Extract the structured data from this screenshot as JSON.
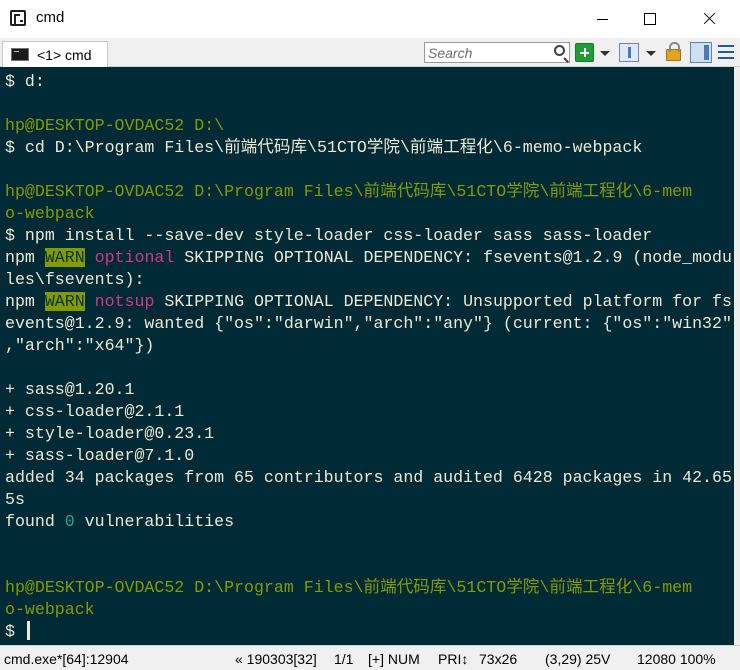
{
  "window": {
    "title": "cmd",
    "tab_label": "<1> cmd"
  },
  "toolbar": {
    "search_placeholder": "Search"
  },
  "console": {
    "lines": [
      [
        {
          "t": "$ d:",
          "c": "text"
        }
      ],
      [
        {
          "t": "",
          "c": "text"
        }
      ],
      [
        {
          "t": "hp@DESKTOP-OVDAC52",
          "c": "user"
        },
        {
          "t": " ",
          "c": "text"
        },
        {
          "t": "D:\\",
          "c": "path"
        }
      ],
      [
        {
          "t": "$ cd D:\\Program Files\\前端代码库\\51CTO学院\\前端工程化\\6-memo-webpack",
          "c": "text"
        }
      ],
      [
        {
          "t": "",
          "c": "text"
        }
      ],
      [
        {
          "t": "hp@DESKTOP-OVDAC52",
          "c": "user"
        },
        {
          "t": " ",
          "c": "text"
        },
        {
          "t": "D:\\Program Files\\前端代码库\\51CTO学院\\前端工程化\\6-mem",
          "c": "path"
        }
      ],
      [
        {
          "t": "o-webpack",
          "c": "path"
        }
      ],
      [
        {
          "t": "$ npm install --save-dev style-loader css-loader sass sass-loader",
          "c": "text"
        }
      ],
      [
        {
          "t": "npm ",
          "c": "text"
        },
        {
          "t": "WARN",
          "c": "warn"
        },
        {
          "t": " ",
          "c": "text"
        },
        {
          "t": "optional",
          "c": "optional"
        },
        {
          "t": " SKIPPING OPTIONAL DEPENDENCY: fsevents@1.2.9 (node_modu",
          "c": "text"
        }
      ],
      [
        {
          "t": "les\\fsevents):",
          "c": "text"
        }
      ],
      [
        {
          "t": "npm ",
          "c": "text"
        },
        {
          "t": "WARN",
          "c": "warn"
        },
        {
          "t": " ",
          "c": "text"
        },
        {
          "t": "notsup",
          "c": "optional"
        },
        {
          "t": " SKIPPING OPTIONAL DEPENDENCY: Unsupported platform for fs",
          "c": "text"
        }
      ],
      [
        {
          "t": "events@1.2.9: wanted {\"os\":\"darwin\",\"arch\":\"any\"} (current: {\"os\":\"win32\"",
          "c": "text"
        }
      ],
      [
        {
          "t": ",\"arch\":\"x64\"})",
          "c": "text"
        }
      ],
      [
        {
          "t": "",
          "c": "text"
        }
      ],
      [
        {
          "t": "+ sass@1.20.1",
          "c": "text"
        }
      ],
      [
        {
          "t": "+ css-loader@2.1.1",
          "c": "text"
        }
      ],
      [
        {
          "t": "+ style-loader@0.23.1",
          "c": "text"
        }
      ],
      [
        {
          "t": "+ sass-loader@7.1.0",
          "c": "text"
        }
      ],
      [
        {
          "t": "added 34 packages from 65 contributors and audited 6428 packages in 42.65",
          "c": "text"
        }
      ],
      [
        {
          "t": "5s",
          "c": "text"
        }
      ],
      [
        {
          "t": "found ",
          "c": "text"
        },
        {
          "t": "0",
          "c": "zero"
        },
        {
          "t": " vulnerabilities",
          "c": "text"
        }
      ],
      [
        {
          "t": "",
          "c": "text"
        }
      ],
      [
        {
          "t": "",
          "c": "text"
        }
      ],
      [
        {
          "t": "hp@DESKTOP-OVDAC52",
          "c": "user"
        },
        {
          "t": " ",
          "c": "text"
        },
        {
          "t": "D:\\Program Files\\前端代码库\\51CTO学院\\前端工程化\\6-mem",
          "c": "path"
        }
      ],
      [
        {
          "t": "o-webpack",
          "c": "path"
        }
      ],
      [
        {
          "t": "$ ",
          "c": "text"
        },
        {
          "t": "",
          "c": "cursor"
        }
      ]
    ]
  },
  "statusbar": {
    "process": "cmd.exe*[64]:12904",
    "buffer": "« 190303[32]",
    "pages": "1/1",
    "num": "[+] NUM",
    "pri": "PRI↕",
    "size": "73x26",
    "cursor_pos": "(3,29) 25V",
    "zoom": "12080 100%"
  }
}
